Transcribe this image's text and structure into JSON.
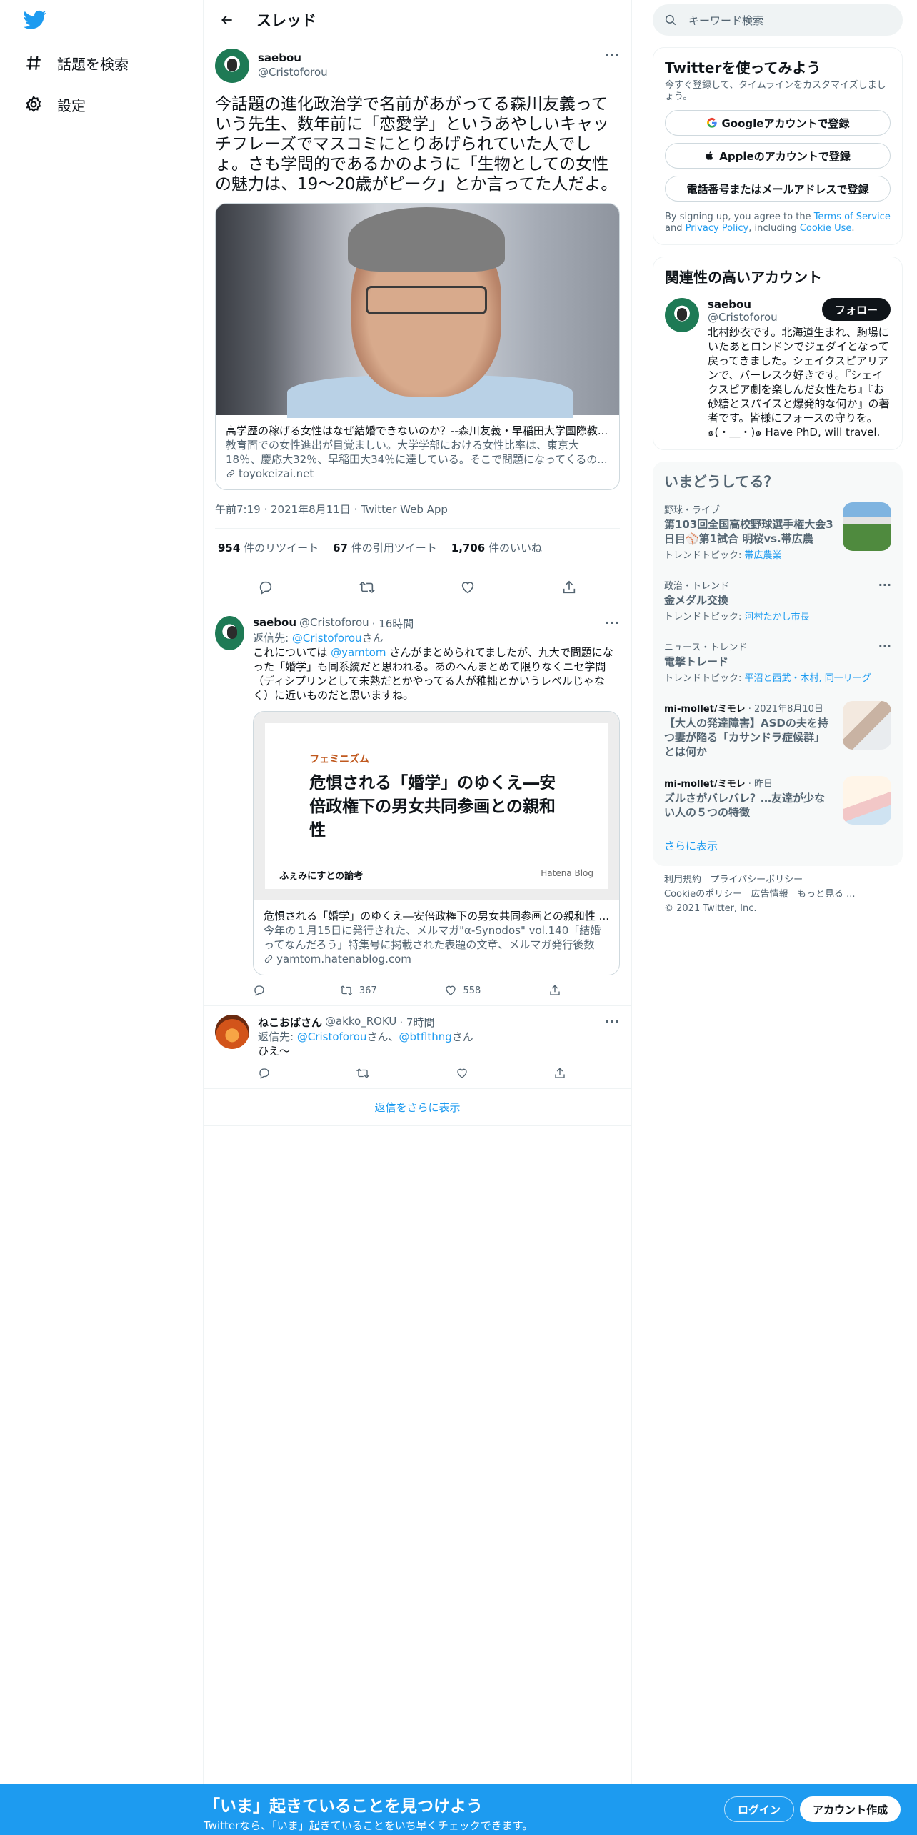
{
  "nav": {
    "explore_label": "話題を検索",
    "settings_label": "設定"
  },
  "header": {
    "title": "スレッド"
  },
  "main_tweet": {
    "name": "saebou",
    "handle": "@Cristoforou",
    "text": "今話題の進化政治学で名前があがってる森川友義っていう先生、数年前に「恋愛学」というあやしいキャッチフレーズでマスコミにとりあげられていた人でしょ。さも学問的であるかのように「生物としての女性の魅力は、19～20歳がピーク」とか言ってた人だよ。",
    "card": {
      "title": "高学歴の稼げる女性はなぜ結婚できないのか？--森川友義・早稲田大学国際教...",
      "description": "教育面での女性進出が目覚ましい。大学学部における女性比率は、東京大18％、慶応大32％、早稲田大34％に達している。そこで問題になってくるの...",
      "domain": "toyokeizai.net"
    },
    "meta": "午前7:19 · 2021年8月11日 · Twitter Web App",
    "retweets_count": "954",
    "retweets_label": "件のリツイート",
    "quotes_count": "67",
    "quotes_label": "件の引用ツイート",
    "likes_count": "1,706",
    "likes_label": "件のいいね"
  },
  "replies": [
    {
      "name": "saebou",
      "handle": "@Cristoforou",
      "time": "· 16時間",
      "reply_to_prefix": "返信先: ",
      "reply_to": "@Cristoforou",
      "reply_to_suffix": "さん",
      "text_before_mention": "これについては ",
      "mention": "@yamtom",
      "text_after_mention": " さんがまとめられてましたが、九大で問題になった「婚学」も同系統だと思われる。あのへんまとめて限りなくニセ学問（ディシプリンとして未熟だとかやってる人が稚拙とかいうレベルじゃなく）に近いものだと思いますね。",
      "card": {
        "category": "フェミニズム",
        "image_title": "危惧される「婚学」のゆくえ―安倍政権下の男女共同参画との親和性",
        "blog_name": "ふぇみにすとの論考",
        "blog_platform": "Hatena Blog",
        "title": "危惧される「婚学」のゆくえ―安倍政権下の男女共同参画との親和性 ...",
        "description": "今年の１月15日に発行された、メルマガ\"α-Synodos\" vol.140「結婚ってなんだろう」特集号に掲載された表題の文章、メルマガ発行後数ヶ...",
        "domain": "yamtom.hatenablog.com"
      },
      "retweets": "367",
      "likes": "558"
    },
    {
      "name": "ねこおばさん",
      "handle": "@akko_ROKU",
      "time": "· 7時間",
      "reply_to_prefix": "返信先: ",
      "reply_to": "@Cristoforou",
      "reply_to_mid": "さん、",
      "reply_to_2": "@btflthng",
      "reply_to_suffix": "さん",
      "text": "ひえ〜"
    }
  ],
  "show_more_replies": "返信をさらに表示",
  "right": {
    "search_placeholder": "キーワード検索",
    "signup": {
      "title": "Twitterを使ってみよう",
      "subtitle": "今すぐ登録して、タイムラインをカスタマイズしましょう。",
      "google": "Googleアカウントで登録",
      "apple": "Appleのアカウントで登録",
      "phone": "電話番号またはメールアドレスで登録",
      "legal_1": "By signing up, you agree to the ",
      "tos": "Terms of Service",
      "legal_2": " and ",
      "privacy": "Privacy Policy",
      "legal_3": ", including ",
      "cookie": "Cookie Use",
      "legal_4": "."
    },
    "related": {
      "title": "関連性の高いアカウント",
      "name": "saebou",
      "handle": "@Cristoforou",
      "follow": "フォロー",
      "bio": "北村紗衣です。北海道生まれ、駒場にいたあとロンドンでジェダイとなって戻ってきました。シェイクスピアリアンで、バーレスク好きです。『シェイクスピア劇を楽しんだ女性たち』『お砂糖とスパイスと爆発的な何か』の著者です。皆様にフォースの守りを。๑(・＿・)๑ Have PhD, will travel."
    },
    "trends": {
      "title": "いまどうしてる？",
      "items": [
        {
          "category": "野球・ライブ",
          "title": "第103回全国高校野球選手権大会3日目⚾第1試合 明桜vs.帯広農",
          "topic_label": "トレンドトピック: ",
          "topic": "帯広農業"
        },
        {
          "category": "政治・トレンド",
          "title": "金メダル交換",
          "topic_label": "トレンドトピック: ",
          "topic": "河村たかし市長"
        },
        {
          "category": "ニュース・トレンド",
          "title": "電撃トレード",
          "topic_label": "トレンドトピック: ",
          "topic": "平沼と西武・木村, 同一リーグ"
        },
        {
          "source": "mi-mollet/ミモレ",
          "time": "· 2021年8月10日",
          "title": "【大人の発達障害】ASDの夫を持つ妻が陥る「カサンドラ症候群」とは何か"
        },
        {
          "source": "mi-mollet/ミモレ",
          "time": "· 昨日",
          "title": "ズルさがバレバレ？…友達が少ない人の５つの特徴"
        }
      ],
      "show_more": "さらに表示"
    },
    "footer": {
      "terms": "利用規約",
      "privacy": "プライバシーポリシー",
      "cookie": "Cookieのポリシー",
      "ads": "広告情報",
      "more": "もっと見る ...",
      "copyright": "© 2021 Twitter, Inc."
    }
  },
  "bottom_bar": {
    "title": "「いま」起きていることを見つけよう",
    "subtitle": "Twitterなら、「いま」起きていることをいち早くチェックできます。",
    "login": "ログイン",
    "signup": "アカウント作成"
  },
  "colors": {
    "accent": "#1d9bf0",
    "text": "#0f1419",
    "secondary": "#536471"
  }
}
